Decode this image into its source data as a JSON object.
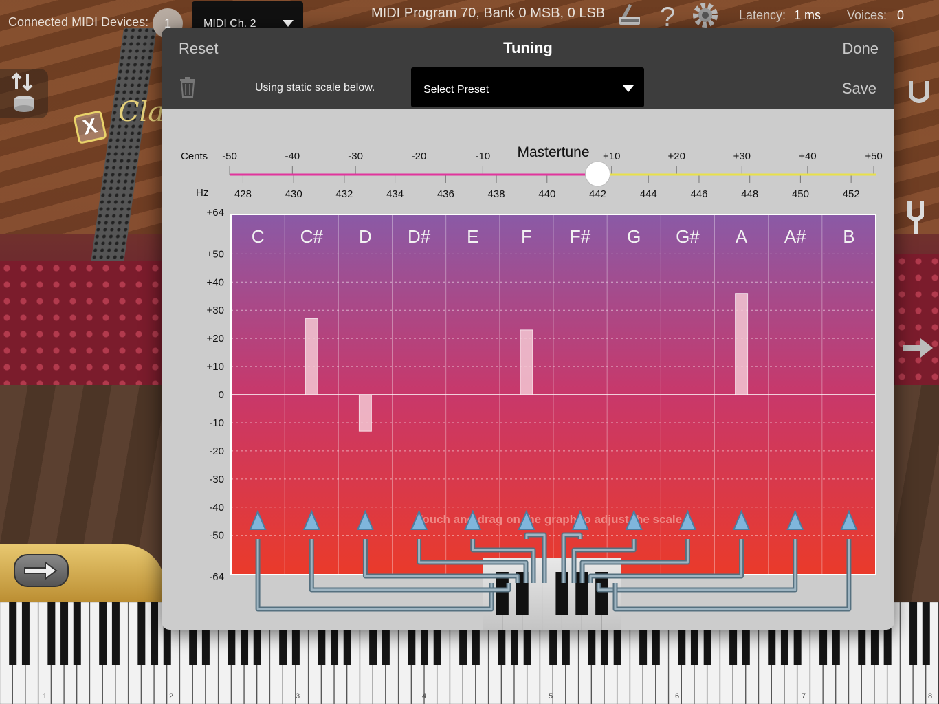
{
  "toolbar": {
    "connected_label": "Connected MIDI Devices:",
    "connected_count": "1",
    "midi_channel": "MIDI Ch. 2",
    "program_info": "MIDI Program 70, Bank 0 MSB, 0 LSB",
    "latency_label": "Latency:",
    "latency_value": "1 ms",
    "voices_label": "Voices:",
    "voices_value": "0",
    "icons": [
      "metronome-icon",
      "help-icon",
      "gear-icon"
    ]
  },
  "background": {
    "instrument_text": "Clas"
  },
  "panel": {
    "reset_label": "Reset",
    "title": "Tuning",
    "done_label": "Done",
    "static_scale_text": "Using static scale below.",
    "preset_label": "Select Preset",
    "save_label": "Save"
  },
  "mastertune": {
    "title": "Mastertune",
    "cents_label": "Cents",
    "hz_label": "Hz",
    "cents_ticks": [
      "-50",
      "-40",
      "-30",
      "-20",
      "-10",
      "+10",
      "+20",
      "+30",
      "+40",
      "+50"
    ],
    "hz_ticks": [
      "428",
      "430",
      "432",
      "434",
      "436",
      "438",
      "440",
      "442",
      "444",
      "446",
      "448",
      "450",
      "452"
    ],
    "value_hz": 442,
    "range_hz": [
      427.5,
      453
    ],
    "colors": {
      "left": "#e0359c",
      "right": "#e8e04a"
    }
  },
  "chart_data": {
    "type": "bar",
    "title": "",
    "xlabel": "",
    "ylabel": "",
    "categories": [
      "C",
      "C#",
      "D",
      "D#",
      "E",
      "F",
      "F#",
      "G",
      "G#",
      "A",
      "A#",
      "B"
    ],
    "values": [
      0,
      27,
      -13,
      0,
      0,
      23,
      0,
      0,
      0,
      36,
      0,
      0
    ],
    "ylim": [
      -64,
      64
    ],
    "y_ticks": [
      "+64",
      "+50",
      "+40",
      "+30",
      "+20",
      "+10",
      "0",
      "-10",
      "-20",
      "-30",
      "-40",
      "-50",
      "-64"
    ],
    "y_tick_values": [
      64,
      50,
      40,
      30,
      20,
      10,
      0,
      -10,
      -20,
      -30,
      -40,
      -50,
      -64
    ],
    "hint": "Touch and drag on the graph to adjust the scale.",
    "colors": {
      "top": "#8a5aa6",
      "middle": "#c8386a",
      "bottom": "#ea3a2a",
      "bar": "#f3c8d4"
    }
  },
  "keyboard": {
    "octave_labels": [
      "1",
      "2",
      "3",
      "4",
      "5",
      "6",
      "7",
      "8"
    ]
  }
}
